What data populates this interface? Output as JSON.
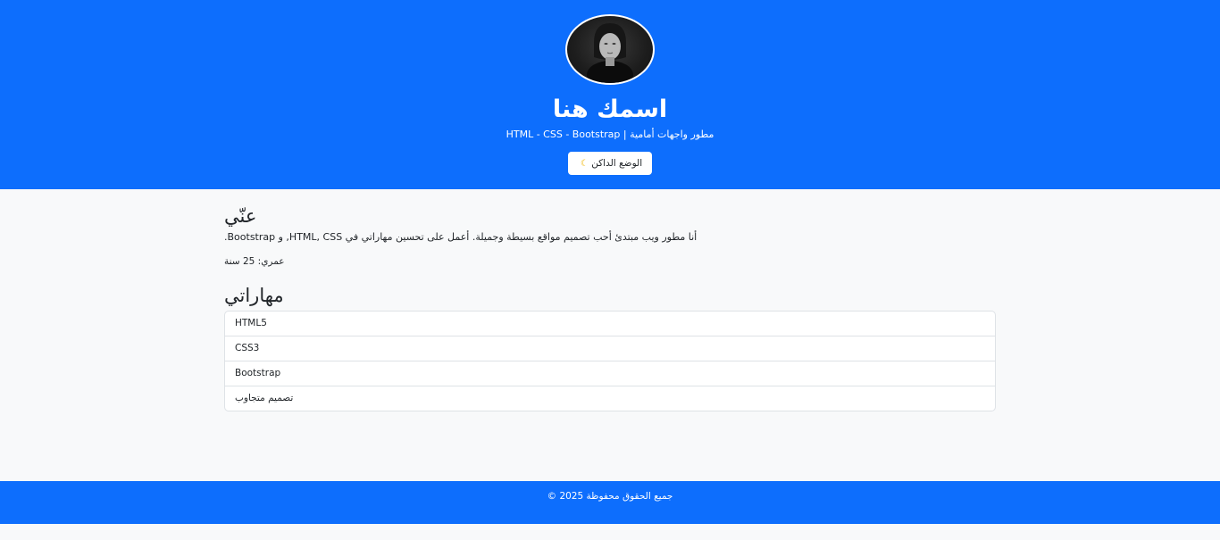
{
  "header": {
    "name": "اسمك هنا",
    "tagline": "مطور واجهات أمامية | HTML - CSS - Bootstrap",
    "dark_mode_button": "الوضع الداكن",
    "dark_mode_icon": "moon-icon"
  },
  "about": {
    "title": "عنّي",
    "text": "أنا مطور ويب مبتدئ أحب تصميم مواقع بسيطة وجميلة. أعمل على تحسين مهاراتي في HTML, CSS, و Bootstrap.",
    "age": "عمري: 25 سنة"
  },
  "skills": {
    "title": "مهاراتي",
    "items": [
      "HTML5",
      "CSS3",
      "Bootstrap",
      "تصميم متجاوب"
    ]
  },
  "footer": {
    "text": "جميع الحقوق محفوظة 2025 ©"
  },
  "colors": {
    "primary": "#0d6efd",
    "background": "#f8f9fa"
  }
}
